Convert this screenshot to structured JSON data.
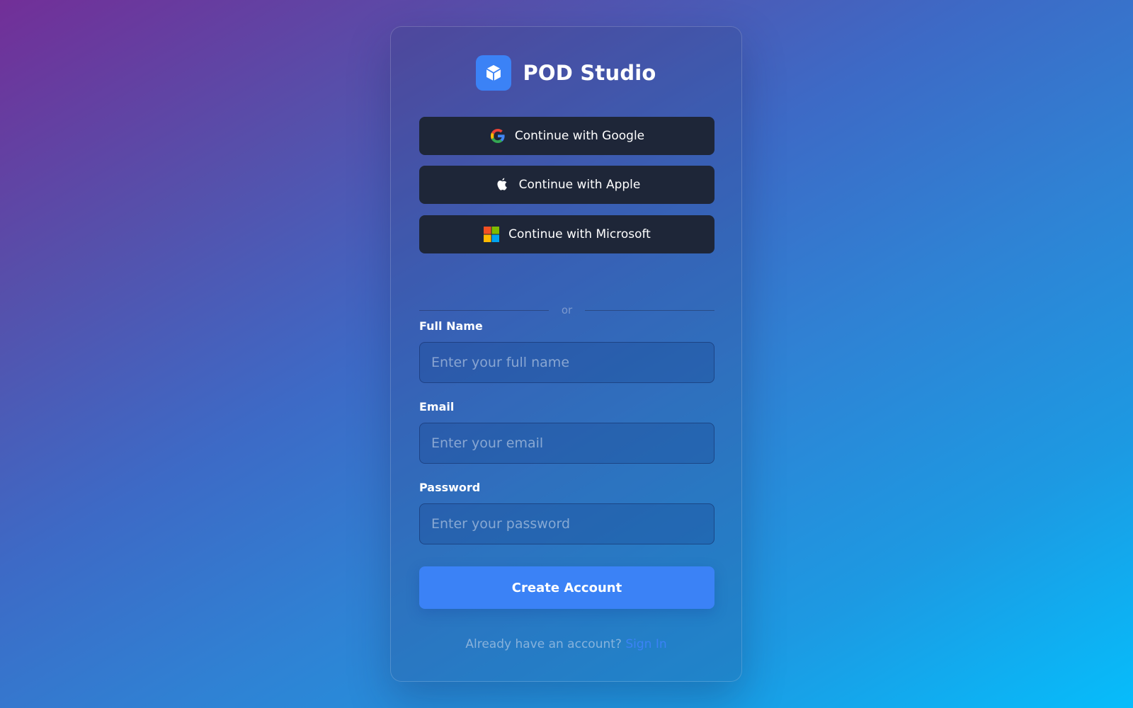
{
  "brand": {
    "name": "POD Studio",
    "logo_icon": "cube-icon",
    "accent_color": "#3b82f6"
  },
  "sso": {
    "google": {
      "label": "Continue with Google",
      "icon": "google-icon"
    },
    "apple": {
      "label": "Continue with Apple",
      "icon": "apple-icon"
    },
    "microsoft": {
      "label": "Continue with Microsoft",
      "icon": "microsoft-icon"
    }
  },
  "divider": {
    "text": "or"
  },
  "form": {
    "full_name": {
      "label": "Full Name",
      "value": "",
      "placeholder": "Enter your full name"
    },
    "email": {
      "label": "Email",
      "value": "",
      "placeholder": "Enter your email"
    },
    "password": {
      "label": "Password",
      "value": "",
      "placeholder": "Enter your password"
    },
    "submit_label": "Create Account"
  },
  "footer": {
    "prompt": "Already have an account?",
    "link_label": "Sign In"
  },
  "colors": {
    "button_dark": "#1e2638",
    "primary": "#3b82f6",
    "link": "#3b82f6"
  }
}
